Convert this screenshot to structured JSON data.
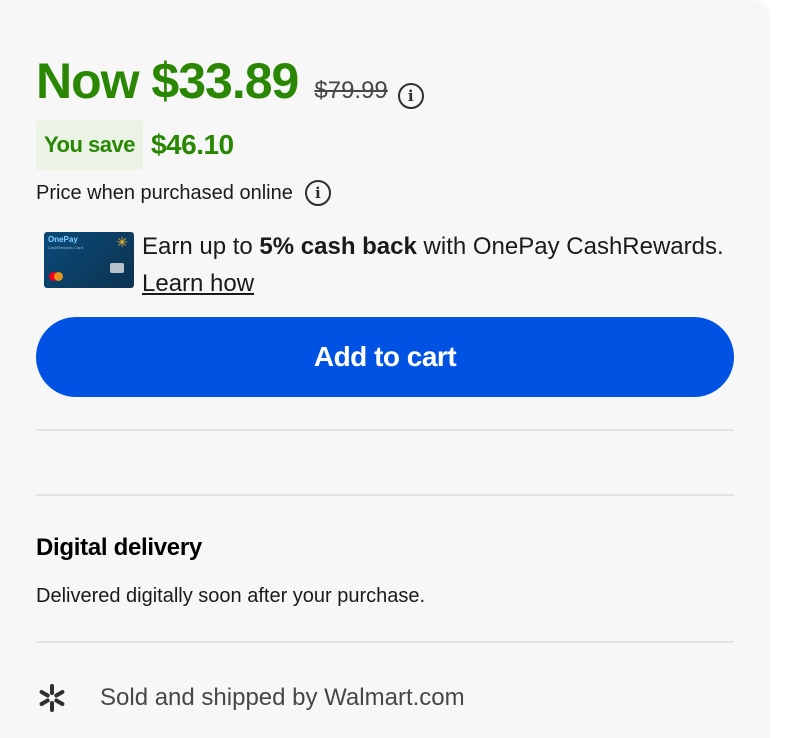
{
  "price": {
    "now": "Now $33.89",
    "was": "$79.99",
    "save_label": "You save",
    "save_amount": "$46.10",
    "online_note": "Price when purchased online"
  },
  "cashback": {
    "card_brand": "OnePay",
    "card_sub": "CashRewards Card",
    "text_prefix": "Earn up to ",
    "text_bold": "5% cash back",
    "text_suffix": " with OnePay CashRewards.",
    "link": "Learn how"
  },
  "actions": {
    "add_to_cart": "Add to cart"
  },
  "delivery": {
    "title": "Digital delivery",
    "description": "Delivered digitally soon after your purchase."
  },
  "seller": {
    "text": "Sold and shipped by Walmart.com"
  },
  "colors": {
    "price_green": "#2a8703",
    "button_blue": "#0053e2",
    "panel_bg": "#f7f7f7"
  },
  "icons": [
    "info-icon",
    "walmart-spark-icon",
    "mastercard-logo"
  ]
}
